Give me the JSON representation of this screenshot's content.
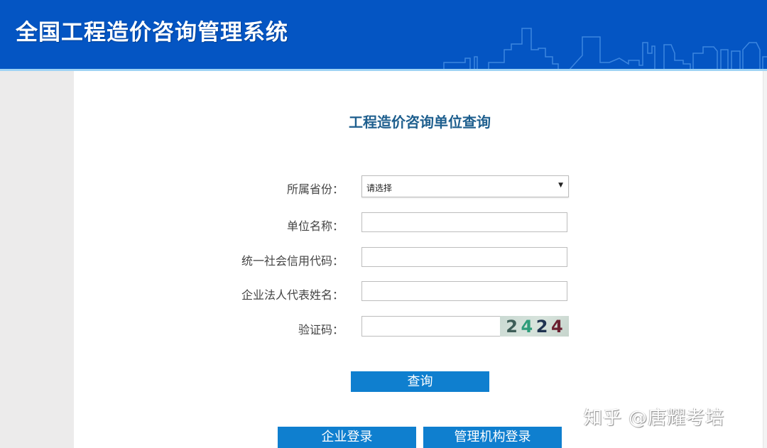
{
  "header": {
    "title": "全国工程造价咨询管理系统",
    "background_color": "#0455c3",
    "decoration": "city-skyline"
  },
  "main": {
    "page_title": "工程造价咨询单位查询",
    "form": {
      "province": {
        "label": "所属省份：",
        "selected": "请选择"
      },
      "company_name": {
        "label": "单位名称：",
        "value": ""
      },
      "credit_code": {
        "label": "统一社会信用代码：",
        "value": ""
      },
      "legal_rep": {
        "label": "企业法人代表姓名：",
        "value": ""
      },
      "captcha": {
        "label": "验证码：",
        "value": "",
        "image_digits": [
          "2",
          "4",
          "2",
          "4"
        ]
      }
    },
    "buttons": {
      "query": "查询",
      "company_login": "企业登录",
      "admin_login": "管理机构登录"
    },
    "button_color": "#0f7fcf"
  },
  "watermark": "知乎 @唐耀考培"
}
